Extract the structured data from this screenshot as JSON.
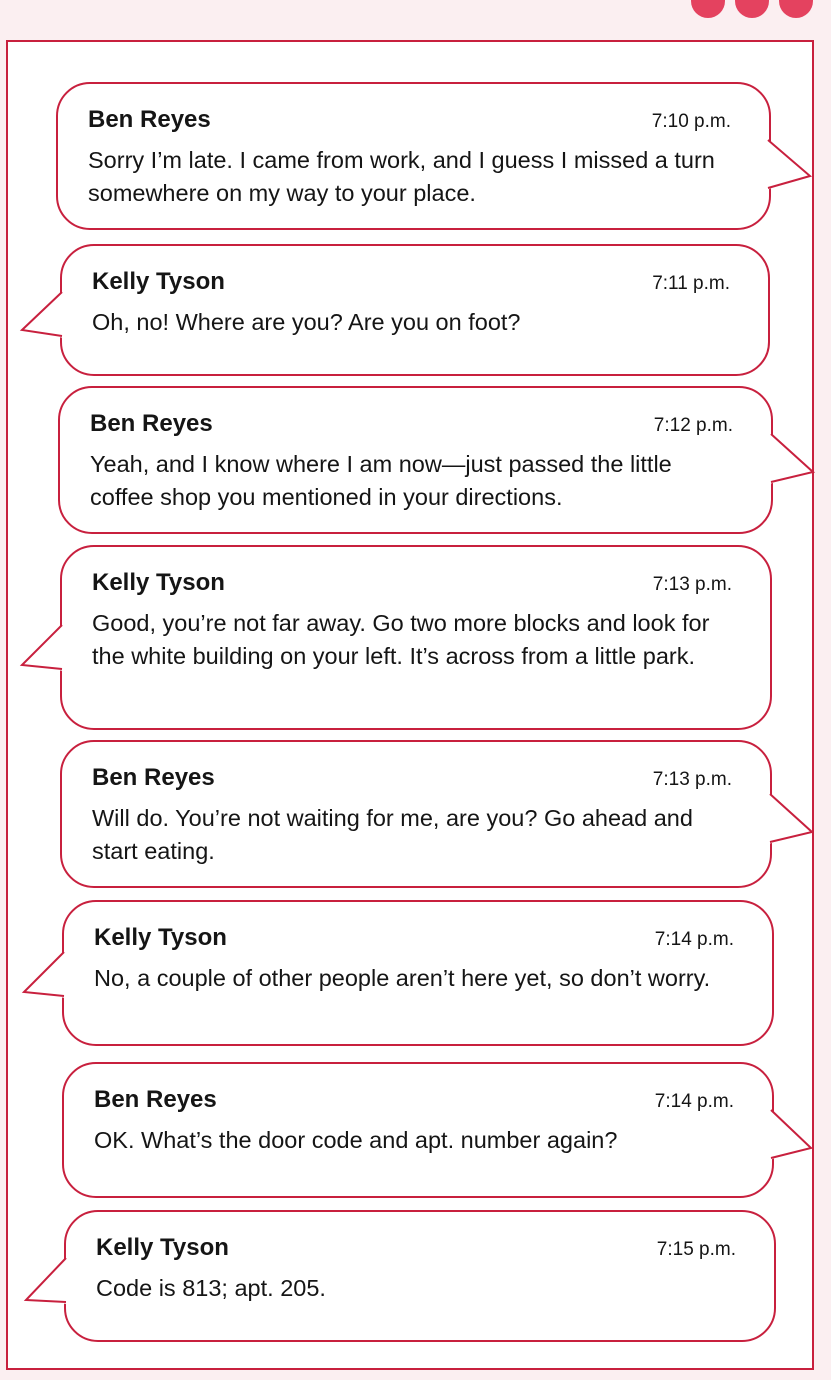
{
  "messages": [
    {
      "sender": "Ben Reyes",
      "time": "7:10 p.m.",
      "text": "Sorry I’m late. I came from work, and I guess I missed a turn somewhere on my way to your place.",
      "side": "right"
    },
    {
      "sender": "Kelly Tyson",
      "time": "7:11 p.m.",
      "text": "Oh, no! Where are you? Are you on foot?",
      "side": "left"
    },
    {
      "sender": "Ben Reyes",
      "time": "7:12 p.m.",
      "text": "Yeah, and I know where I am now—just passed the little coffee shop you mentioned in your directions.",
      "side": "right"
    },
    {
      "sender": "Kelly Tyson",
      "time": "7:13 p.m.",
      "text": "Good, you’re not far away. Go two more blocks and look for the white building on your left. It’s across from a little park.",
      "side": "left"
    },
    {
      "sender": "Ben Reyes",
      "time": "7:13 p.m.",
      "text": "Will do. You’re not waiting for me, are you? Go ahead and start eating.",
      "side": "right"
    },
    {
      "sender": "Kelly Tyson",
      "time": "7:14 p.m.",
      "text": "No, a couple of other people aren’t here yet, so don’t worry.",
      "side": "left"
    },
    {
      "sender": "Ben Reyes",
      "time": "7:14 p.m.",
      "text": "OK. What’s the door code and apt. number again?",
      "side": "right"
    },
    {
      "sender": "Kelly Tyson",
      "time": "7:15 p.m.",
      "text": "Code is 813; apt. 205.",
      "side": "left"
    }
  ],
  "colors": {
    "accent": "#c8203e",
    "page_background": "#fbeff1",
    "dots": "#e4425f"
  }
}
